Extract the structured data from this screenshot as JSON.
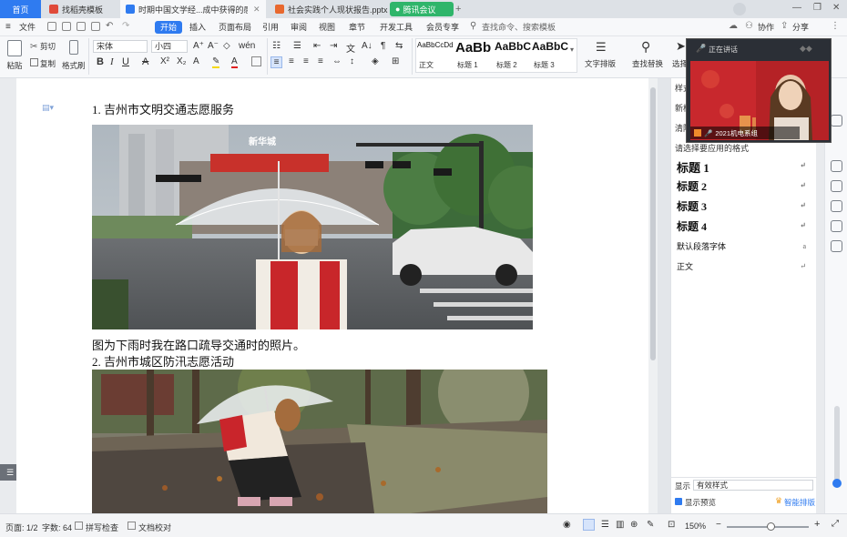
{
  "tabs": [
    {
      "label": "首页",
      "type": "home"
    },
    {
      "label": "找稻壳模板",
      "type": "normal",
      "color": "#e04a39"
    },
    {
      "label": "时期中国文学经...成中获得的感受.docx",
      "type": "active",
      "color": "#2f7bf0"
    },
    {
      "label": "社会实践个人现状报告.pptx",
      "type": "normal",
      "color": "#e8682e"
    },
    {
      "label": "腾讯会议",
      "type": "meeting",
      "color": "#2fb56a"
    }
  ],
  "menu": {
    "file": "文件",
    "items": [
      "开始",
      "插入",
      "页面布局",
      "引用",
      "审阅",
      "视图",
      "章节",
      "开发工具",
      "会员专享"
    ],
    "search": "查找命令、搜索模板",
    "share": "分享",
    "collab": "协作",
    "selected": "开始"
  },
  "ribbon": {
    "paste": "粘贴",
    "cut": "剪切",
    "copy": "复制",
    "format_painter": "格式刷",
    "font_name": "宋体",
    "font_size": "小四",
    "styles": [
      {
        "sample": "AaBbCcDd",
        "caption": "正文"
      },
      {
        "sample": "AaBb",
        "caption": "标题 1"
      },
      {
        "sample": "AaBbC",
        "caption": "标题 2"
      },
      {
        "sample": "AaBbC",
        "caption": "标题 3"
      }
    ],
    "text_layout": "文字排版",
    "find_replace": "查找替换",
    "select": "选择"
  },
  "document": {
    "heading1": "1. 吉州市文明交通志愿服务",
    "caption1": "图为下雨时我在路口疏导交通时的照片。",
    "heading2": "2. 吉州市城区防汛志愿活动",
    "store_sign": "新华城"
  },
  "style_panel": {
    "title": "样式",
    "new_style": "新样式",
    "clear_format": "清除格式",
    "hint": "请选择要应用的格式",
    "items": [
      {
        "label": "标题  1",
        "level": "h1"
      },
      {
        "label": "标题  2",
        "level": "h2"
      },
      {
        "label": "标题  3",
        "level": "h3"
      },
      {
        "label": "标题  4",
        "level": "h4"
      },
      {
        "label": "默认段落字体",
        "level": "normal"
      },
      {
        "label": "正文",
        "level": "normal"
      }
    ],
    "show_label": "显示",
    "show_value": "有效样式",
    "preview_label": "显示预览",
    "smart_layout": "智能排版"
  },
  "video": {
    "title": "正在讲话",
    "participant": "2021机电系组"
  },
  "status": {
    "page": "页面: 1/2",
    "words": "字数: 64",
    "spell": "拼写检查",
    "doc_check": "文档校对",
    "zoom": "150%"
  },
  "colors": {
    "accent": "#2f7bf0",
    "home_tab": "#2f7bf0",
    "wps_red": "#e04a39"
  }
}
